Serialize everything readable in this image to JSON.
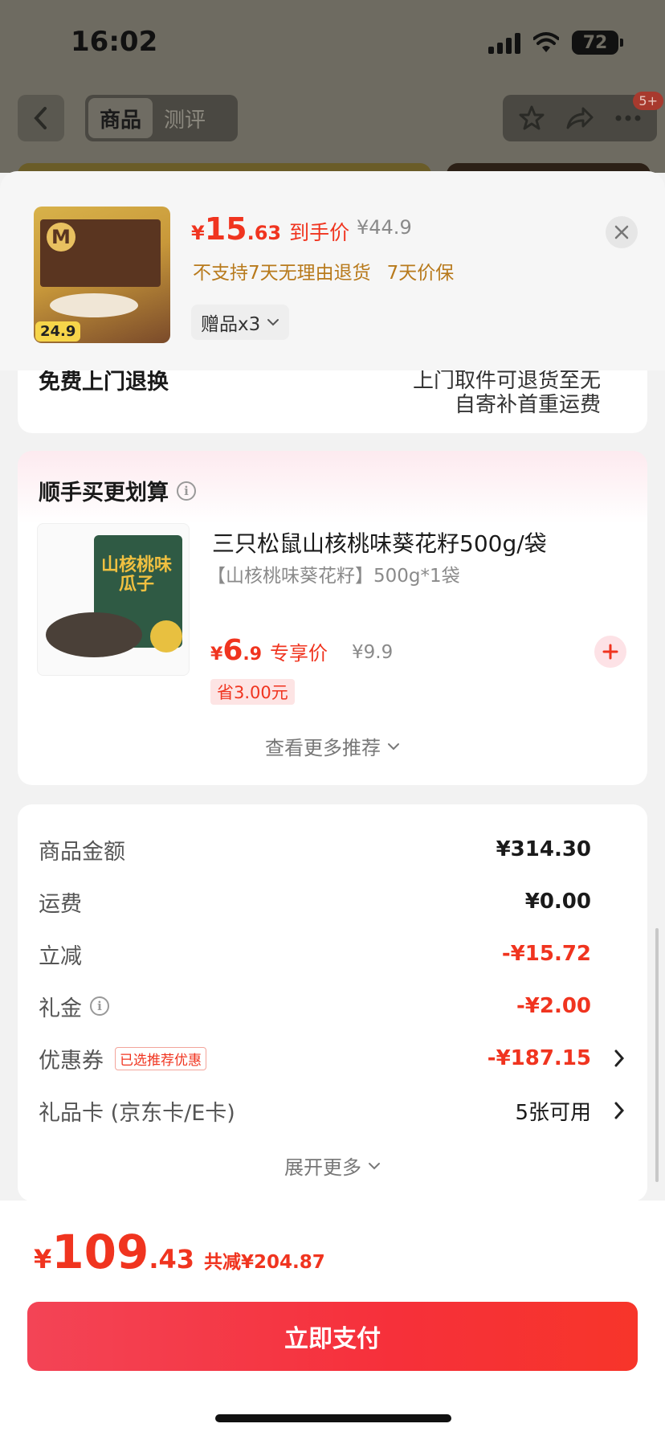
{
  "status_bar": {
    "time": "16:02",
    "battery": "72"
  },
  "nav": {
    "tabs": [
      {
        "label": "商品"
      },
      {
        "label": "测评"
      }
    ],
    "badge": "5+"
  },
  "sheet_header": {
    "thumb_price_tag": "24.9",
    "price_symbol": "¥",
    "price_int": "15",
    "price_dec": ".63",
    "price_label": "到手价",
    "original_price": "¥44.9",
    "policy_1": "不支持7天无理由退货",
    "policy_2": "7天价保",
    "gift_label": "赠品x3"
  },
  "return_card": {
    "label": "免费上门退换",
    "value_line_1": "上门取件可退货至无",
    "value_line_2": "自寄补首重运费"
  },
  "recommend": {
    "title": "顺手买更划算",
    "product_name": "三只松鼠山核桃味葵花籽500g/袋",
    "product_spec": "【山核桃味葵花籽】500g*1袋",
    "image_text": "山核桃味瓜子",
    "price_symbol": "¥",
    "price_int": "6",
    "price_dec": ".9",
    "price_label": "专享价",
    "original_price": "¥9.9",
    "save_tag": "省3.00元",
    "more": "查看更多推荐"
  },
  "summary": {
    "rows": [
      {
        "label": "商品金额",
        "value": "¥314.30"
      },
      {
        "label": "运费",
        "value": "¥0.00"
      },
      {
        "label": "立减",
        "value": "-¥15.72"
      },
      {
        "label": "礼金",
        "value": "-¥2.00"
      },
      {
        "label": "优惠券",
        "tag": "已选推荐优惠",
        "value": "-¥187.15"
      },
      {
        "label": "礼品卡 (京东卡/E卡)",
        "value": "5张可用"
      }
    ],
    "expand": "展开更多"
  },
  "footer": {
    "price_symbol": "¥",
    "total_int": "109",
    "total_dec": ".43",
    "saved": "共减¥204.87",
    "pay_label": "立即支付"
  },
  "colors": {
    "accent": "#f0341f",
    "policy": "#b87a1c",
    "pay_button": "#f6303a"
  }
}
